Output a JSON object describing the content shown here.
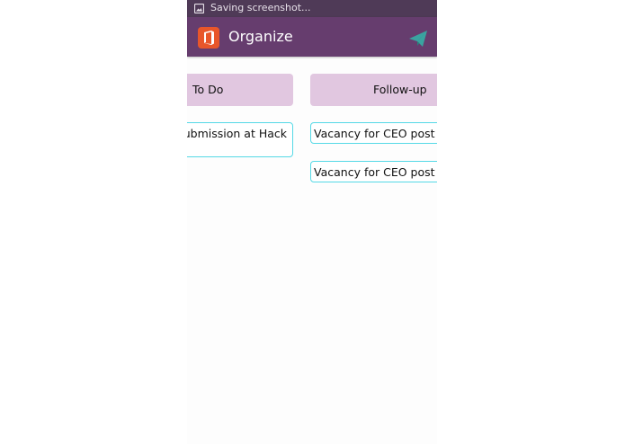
{
  "status_bar": {
    "notification_icon": "image-icon",
    "text": "Saving screenshot..."
  },
  "app_bar": {
    "logo_icon": "office-logo-icon",
    "title": "Organize",
    "action_icon": "send-icon"
  },
  "columns": [
    {
      "header": "To Do",
      "cards": [
        "submission at Hack"
      ]
    },
    {
      "header": "Follow-up",
      "cards": [
        "Vacancy for CEO post",
        "Vacancy for CEO post"
      ]
    }
  ],
  "colors": {
    "status_bar": "#4f3a57",
    "app_bar": "#663d6e",
    "column_header": "#e1c7e0",
    "card_border": "#55d9e6",
    "send_icon": "#3aa3a0",
    "logo": "#e8562a"
  }
}
